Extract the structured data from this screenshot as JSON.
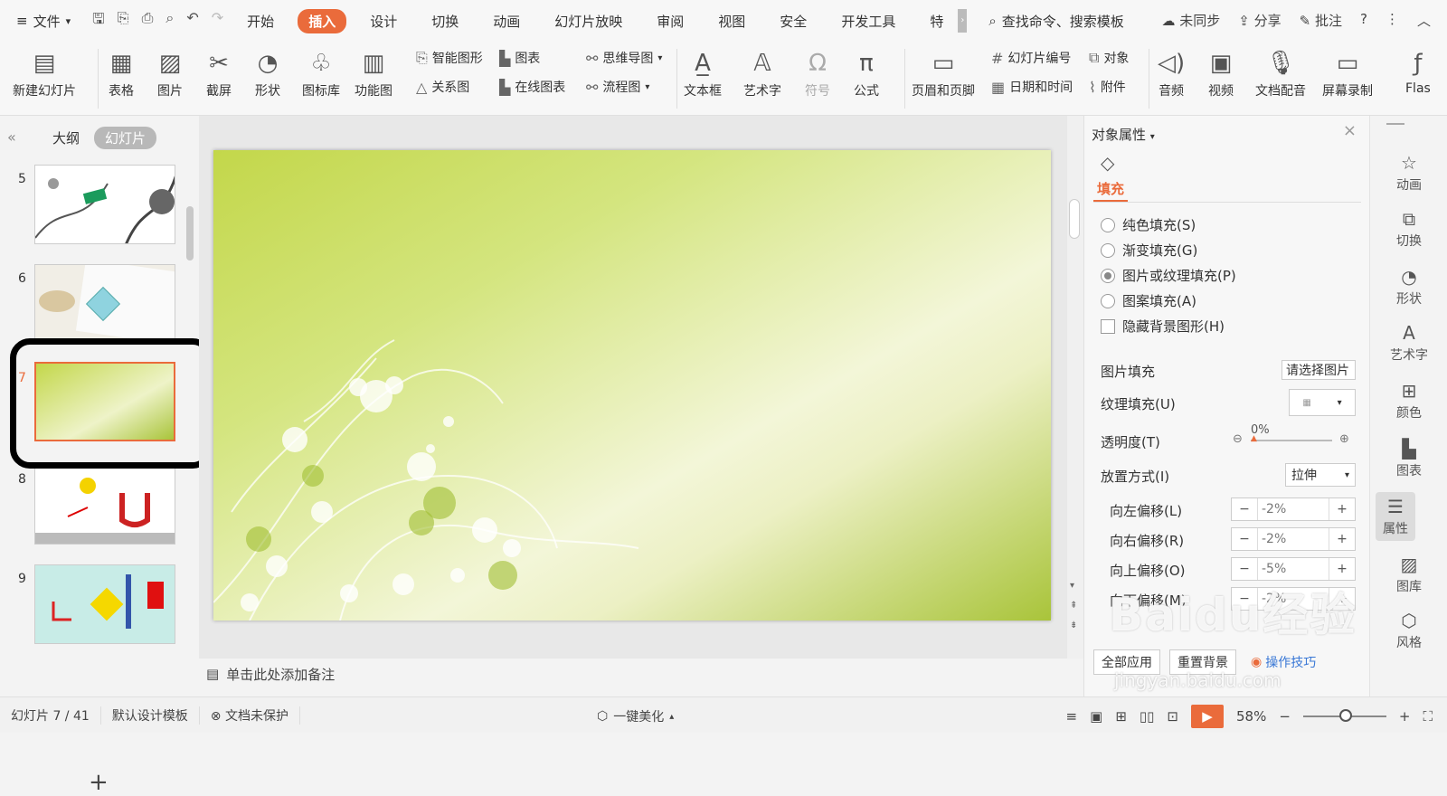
{
  "menu": {
    "file": "文件"
  },
  "tabs": [
    {
      "label": "开始"
    },
    {
      "label": "插入",
      "active": true
    },
    {
      "label": "设计"
    },
    {
      "label": "切换"
    },
    {
      "label": "动画"
    },
    {
      "label": "幻灯片放映"
    },
    {
      "label": "审阅"
    },
    {
      "label": "视图"
    },
    {
      "label": "安全"
    },
    {
      "label": "开发工具"
    },
    {
      "label": "特"
    }
  ],
  "search": {
    "placeholder": "查找命令、搜索模板"
  },
  "topright": {
    "sync": "未同步",
    "share": "分享",
    "comment": "批注"
  },
  "ribbon": {
    "new_slide": "新建幻灯片",
    "table": "表格",
    "image": "图片",
    "screenshot": "截屏",
    "shape": "形状",
    "iconlib": "图标库",
    "funcchart": "功能图",
    "smartart": "智能图形",
    "chart": "图表",
    "relation": "关系图",
    "online_chart": "在线图表",
    "mindmap": "思维导图",
    "flowchart": "流程图",
    "textbox": "文本框",
    "wordart": "艺术字",
    "symbol": "符号",
    "formula": "公式",
    "header_footer": "页眉和页脚",
    "slide_number": "幻灯片编号",
    "object": "对象",
    "datetime": "日期和时间",
    "attachment": "附件",
    "audio": "音频",
    "video": "视频",
    "voiceover": "文档配音",
    "screenrec": "屏幕录制",
    "flash": "Flas"
  },
  "left": {
    "tab_outline": "大纲",
    "tab_slides": "幻灯片",
    "slides": [
      {
        "n": "5"
      },
      {
        "n": "6"
      },
      {
        "n": "7"
      },
      {
        "n": "8"
      },
      {
        "n": "9"
      }
    ],
    "add": "+"
  },
  "notes": {
    "placeholder": "单击此处添加备注"
  },
  "panel": {
    "title": "对象属性",
    "fill_tab": "填充",
    "options": [
      {
        "label": "纯色填充(S)"
      },
      {
        "label": "渐变填充(G)"
      },
      {
        "label": "图片或纹理填充(P)",
        "selected": true
      },
      {
        "label": "图案填充(A)"
      }
    ],
    "hide_bg": "隐藏背景图形(H)",
    "pic_fill": "图片填充",
    "pic_fill_value": "请选择图片",
    "texture_fill": "纹理填充(U)",
    "transparency": "透明度(T)",
    "transparency_value": "0%",
    "placement": "放置方式(I)",
    "placement_value": "拉伸",
    "offsets": [
      {
        "label": "向左偏移(L)",
        "value": "-2%"
      },
      {
        "label": "向右偏移(R)",
        "value": "-2%"
      },
      {
        "label": "向上偏移(O)",
        "value": "-5%"
      },
      {
        "label": "向下偏移(M)",
        "value": "-2%"
      }
    ],
    "apply_all": "全部应用",
    "reset_bg": "重置背景",
    "tips": "操作技巧"
  },
  "rightbar": [
    {
      "label": "动画"
    },
    {
      "label": "切换"
    },
    {
      "label": "形状"
    },
    {
      "label": "艺术字"
    },
    {
      "label": "颜色"
    },
    {
      "label": "图表"
    },
    {
      "label": "属性"
    },
    {
      "label": "图库"
    },
    {
      "label": "风格"
    }
  ],
  "status": {
    "slide_info": "幻灯片 7 / 41",
    "template": "默认设计模板",
    "protect": "文档未保护",
    "beautify": "一键美化",
    "zoom": "58%"
  },
  "watermark": {
    "logo": "Baidu经验",
    "url": "jingyan.baidu.com"
  }
}
